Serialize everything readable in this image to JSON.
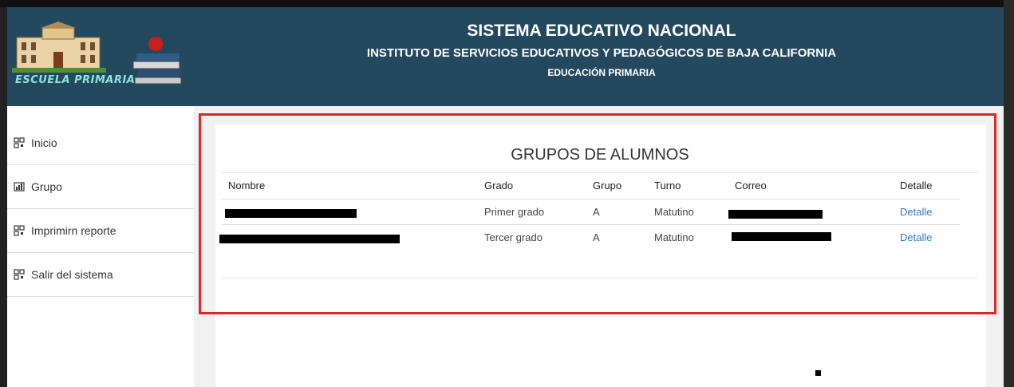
{
  "header": {
    "logo_text": "ESCUELA PRIMARIA",
    "title": "SISTEMA EDUCATIVO NACIONAL",
    "subtitle": "INSTITUTO DE SERVICIOS EDUCATIVOS Y PEDAGÓGICOS DE BAJA CALIFORNIA",
    "subtitle2": "EDUCACIÓN PRIMARIA"
  },
  "sidebar": {
    "items": [
      {
        "label": "Inicio",
        "icon": "qr-icon"
      },
      {
        "label": "Grupo",
        "icon": "bar-chart-icon"
      },
      {
        "label": "Imprimirn reporte",
        "icon": "qr-icon"
      },
      {
        "label": "Salir del sistema",
        "icon": "qr-icon"
      }
    ]
  },
  "main": {
    "title": "GRUPOS DE ALUMNOS",
    "columns": [
      "Nombre",
      "Grado",
      "Grupo",
      "Turno",
      "Correo",
      "Detalle"
    ],
    "rows": [
      {
        "nombre": "",
        "grado": "Primer grado",
        "grupo": "A",
        "turno": "Matutino",
        "correo": "",
        "detalle": "Detalle"
      },
      {
        "nombre": "",
        "grado": "Tercer grado",
        "grupo": "A",
        "turno": "Matutino",
        "correo": "",
        "detalle": "Detalle"
      }
    ]
  },
  "colors": {
    "header_bg": "#24495f",
    "highlight_border": "#e3222a",
    "link": "#337ab7"
  }
}
